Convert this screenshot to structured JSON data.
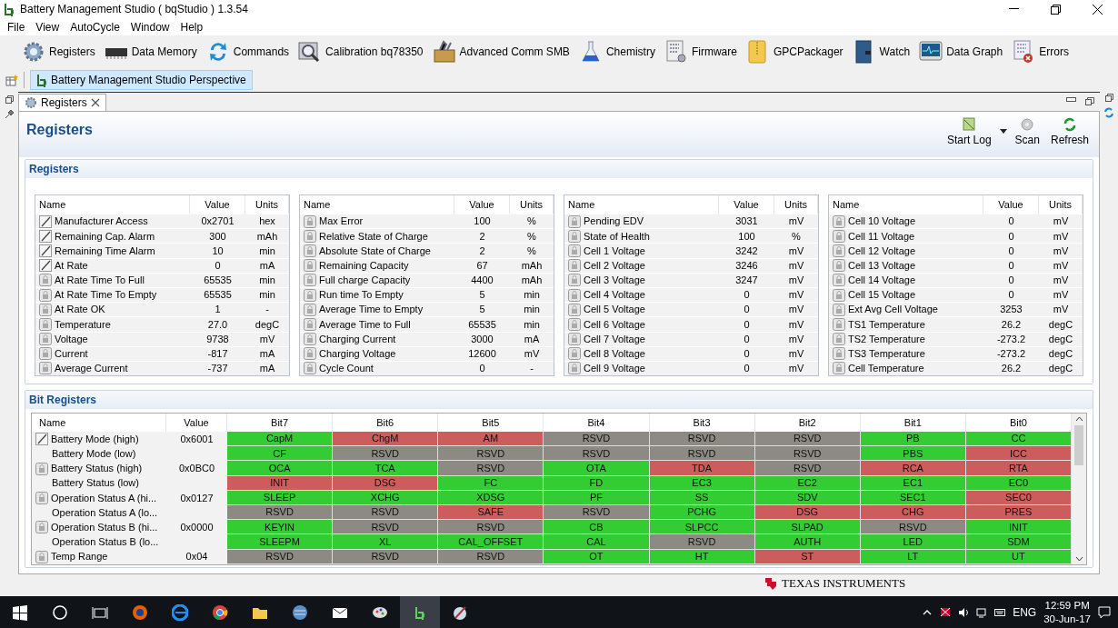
{
  "window": {
    "title": "Battery Management Studio ( bqStudio ) 1.3.54"
  },
  "menu": [
    "File",
    "View",
    "AutoCycle",
    "Window",
    "Help"
  ],
  "toolbar": [
    "Registers",
    "Data Memory",
    "Commands",
    "Calibration bq78350",
    "Advanced Comm SMB",
    "Chemistry",
    "Firmware",
    "GPCPackager",
    "Watch",
    "Data Graph",
    "Errors"
  ],
  "perspective": {
    "label": "Battery Management Studio Perspective",
    "selected": true
  },
  "view_tab": {
    "label": "Registers"
  },
  "page": {
    "title": "Registers",
    "actions": [
      "Start Log",
      "Scan",
      "Refresh"
    ]
  },
  "registers": {
    "title": "Registers",
    "tables": [
      {
        "columns": [
          "Name",
          "Value",
          "Units"
        ],
        "rows": [
          {
            "name": "Manufacturer Access",
            "value": "0x2701",
            "units": "hex",
            "kind": "writable"
          },
          {
            "name": "Remaining Cap. Alarm",
            "value": "300",
            "units": "mAh",
            "kind": "writable"
          },
          {
            "name": "Remaining Time Alarm",
            "value": "10",
            "units": "min",
            "kind": "writable"
          },
          {
            "name": "At Rate",
            "value": "0",
            "units": "mA",
            "kind": "writable"
          },
          {
            "name": "At Rate Time To Full",
            "value": "65535",
            "units": "min",
            "kind": "readonly"
          },
          {
            "name": "At Rate Time To Empty",
            "value": "65535",
            "units": "min",
            "kind": "readonly"
          },
          {
            "name": "At Rate OK",
            "value": "1",
            "units": "-",
            "kind": "readonly"
          },
          {
            "name": "Temperature",
            "value": "27.0",
            "units": "degC",
            "kind": "readonly"
          },
          {
            "name": "Voltage",
            "value": "9738",
            "units": "mV",
            "kind": "readonly"
          },
          {
            "name": "Current",
            "value": "-817",
            "units": "mA",
            "kind": "readonly"
          },
          {
            "name": "Average Current",
            "value": "-737",
            "units": "mA",
            "kind": "readonly"
          }
        ]
      },
      {
        "columns": [
          "Name",
          "Value",
          "Units"
        ],
        "rows": [
          {
            "name": "Max Error",
            "value": "100",
            "units": "%",
            "kind": "readonly"
          },
          {
            "name": "Relative State of Charge",
            "value": "2",
            "units": "%",
            "kind": "readonly"
          },
          {
            "name": "Absolute State of Charge",
            "value": "2",
            "units": "%",
            "kind": "readonly"
          },
          {
            "name": "Remaining Capacity",
            "value": "67",
            "units": "mAh",
            "kind": "readonly"
          },
          {
            "name": "Full charge Capacity",
            "value": "4400",
            "units": "mAh",
            "kind": "readonly"
          },
          {
            "name": "Run time To Empty",
            "value": "5",
            "units": "min",
            "kind": "readonly"
          },
          {
            "name": "Average Time to Empty",
            "value": "5",
            "units": "min",
            "kind": "readonly"
          },
          {
            "name": "Average Time to Full",
            "value": "65535",
            "units": "min",
            "kind": "readonly"
          },
          {
            "name": "Charging Current",
            "value": "3000",
            "units": "mA",
            "kind": "readonly"
          },
          {
            "name": "Charging Voltage",
            "value": "12600",
            "units": "mV",
            "kind": "readonly"
          },
          {
            "name": "Cycle Count",
            "value": "0",
            "units": "-",
            "kind": "readonly"
          }
        ]
      },
      {
        "columns": [
          "Name",
          "Value",
          "Units"
        ],
        "rows": [
          {
            "name": "Pending EDV",
            "value": "3031",
            "units": "mV",
            "kind": "readonly"
          },
          {
            "name": "State of Health",
            "value": "100",
            "units": "%",
            "kind": "readonly"
          },
          {
            "name": "Cell 1 Voltage",
            "value": "3242",
            "units": "mV",
            "kind": "readonly"
          },
          {
            "name": "Cell 2 Voltage",
            "value": "3246",
            "units": "mV",
            "kind": "readonly"
          },
          {
            "name": "Cell 3 Voltage",
            "value": "3247",
            "units": "mV",
            "kind": "readonly"
          },
          {
            "name": "Cell 4 Voltage",
            "value": "0",
            "units": "mV",
            "kind": "readonly"
          },
          {
            "name": "Cell 5 Voltage",
            "value": "0",
            "units": "mV",
            "kind": "readonly"
          },
          {
            "name": "Cell 6 Voltage",
            "value": "0",
            "units": "mV",
            "kind": "readonly"
          },
          {
            "name": "Cell 7 Voltage",
            "value": "0",
            "units": "mV",
            "kind": "readonly"
          },
          {
            "name": "Cell 8 Voltage",
            "value": "0",
            "units": "mV",
            "kind": "readonly"
          },
          {
            "name": "Cell 9 Voltage",
            "value": "0",
            "units": "mV",
            "kind": "readonly"
          }
        ]
      },
      {
        "columns": [
          "Name",
          "Value",
          "Units"
        ],
        "rows": [
          {
            "name": "Cell 10 Voltage",
            "value": "0",
            "units": "mV",
            "kind": "readonly"
          },
          {
            "name": "Cell 11 Voltage",
            "value": "0",
            "units": "mV",
            "kind": "readonly"
          },
          {
            "name": "Cell 12 Voltage",
            "value": "0",
            "units": "mV",
            "kind": "readonly"
          },
          {
            "name": "Cell 13 Voltage",
            "value": "0",
            "units": "mV",
            "kind": "readonly"
          },
          {
            "name": "Cell 14 Voltage",
            "value": "0",
            "units": "mV",
            "kind": "readonly"
          },
          {
            "name": "Cell 15 Voltage",
            "value": "0",
            "units": "mV",
            "kind": "readonly"
          },
          {
            "name": "Ext Avg Cell Voltage",
            "value": "3253",
            "units": "mV",
            "kind": "readonly"
          },
          {
            "name": "TS1 Temperature",
            "value": "26.2",
            "units": "degC",
            "kind": "readonly"
          },
          {
            "name": "TS2 Temperature",
            "value": "-273.2",
            "units": "degC",
            "kind": "readonly"
          },
          {
            "name": "TS3 Temperature",
            "value": "-273.2",
            "units": "degC",
            "kind": "readonly"
          },
          {
            "name": "Cell Temperature",
            "value": "26.2",
            "units": "degC",
            "kind": "readonly"
          }
        ]
      }
    ]
  },
  "bit_registers": {
    "title": "Bit Registers",
    "columns": [
      "Name",
      "Value",
      "Bit7",
      "Bit6",
      "Bit5",
      "Bit4",
      "Bit3",
      "Bit2",
      "Bit1",
      "Bit0"
    ],
    "rows": [
      {
        "name": "Battery Mode (high)",
        "value": "0x6001",
        "kind": "writable",
        "bits": [
          {
            "label": "CapM",
            "color": "#33cc33"
          },
          {
            "label": "ChgM",
            "color": "#cd5c5c"
          },
          {
            "label": "AM",
            "color": "#cd5c5c"
          },
          {
            "label": "RSVD",
            "color": "#8c8a82"
          },
          {
            "label": "RSVD",
            "color": "#8c8a82"
          },
          {
            "label": "RSVD",
            "color": "#8c8a82"
          },
          {
            "label": "PB",
            "color": "#33cc33"
          },
          {
            "label": "CC",
            "color": "#33cc33"
          }
        ]
      },
      {
        "name": "Battery Mode (low)",
        "kind": "sub",
        "bits": [
          {
            "label": "CF",
            "color": "#33cc33"
          },
          {
            "label": "RSVD",
            "color": "#8c8a82"
          },
          {
            "label": "RSVD",
            "color": "#8c8a82"
          },
          {
            "label": "RSVD",
            "color": "#8c8a82"
          },
          {
            "label": "RSVD",
            "color": "#8c8a82"
          },
          {
            "label": "RSVD",
            "color": "#8c8a82"
          },
          {
            "label": "PBS",
            "color": "#33cc33"
          },
          {
            "label": "ICC",
            "color": "#cd5c5c"
          }
        ]
      },
      {
        "name": "Battery Status (high)",
        "value": "0x0BC0",
        "kind": "readonly",
        "bits": [
          {
            "label": "OCA",
            "color": "#33cc33"
          },
          {
            "label": "TCA",
            "color": "#33cc33"
          },
          {
            "label": "RSVD",
            "color": "#8c8a82"
          },
          {
            "label": "OTA",
            "color": "#33cc33"
          },
          {
            "label": "TDA",
            "color": "#cd5c5c"
          },
          {
            "label": "RSVD",
            "color": "#8c8a82"
          },
          {
            "label": "RCA",
            "color": "#cd5c5c"
          },
          {
            "label": "RTA",
            "color": "#cd5c5c"
          }
        ]
      },
      {
        "name": "Battery Status (low)",
        "kind": "sub",
        "bits": [
          {
            "label": "INIT",
            "color": "#cd5c5c"
          },
          {
            "label": "DSG",
            "color": "#cd5c5c"
          },
          {
            "label": "FC",
            "color": "#33cc33"
          },
          {
            "label": "FD",
            "color": "#33cc33"
          },
          {
            "label": "EC3",
            "color": "#33cc33"
          },
          {
            "label": "EC2",
            "color": "#33cc33"
          },
          {
            "label": "EC1",
            "color": "#33cc33"
          },
          {
            "label": "EC0",
            "color": "#33cc33"
          }
        ]
      },
      {
        "name": "Operation Status A (hi...",
        "value": "0x0127",
        "kind": "readonly",
        "bits": [
          {
            "label": "SLEEP",
            "color": "#33cc33"
          },
          {
            "label": "XCHG",
            "color": "#33cc33"
          },
          {
            "label": "XDSG",
            "color": "#33cc33"
          },
          {
            "label": "PF",
            "color": "#33cc33"
          },
          {
            "label": "SS",
            "color": "#33cc33"
          },
          {
            "label": "SDV",
            "color": "#33cc33"
          },
          {
            "label": "SEC1",
            "color": "#33cc33"
          },
          {
            "label": "SEC0",
            "color": "#cd5c5c"
          }
        ]
      },
      {
        "name": "Operation Status A (lo...",
        "kind": "sub",
        "bits": [
          {
            "label": "RSVD",
            "color": "#8c8a82"
          },
          {
            "label": "RSVD",
            "color": "#8c8a82"
          },
          {
            "label": "SAFE",
            "color": "#cd5c5c"
          },
          {
            "label": "RSVD",
            "color": "#8c8a82"
          },
          {
            "label": "PCHG",
            "color": "#33cc33"
          },
          {
            "label": "DSG",
            "color": "#cd5c5c"
          },
          {
            "label": "CHG",
            "color": "#cd5c5c"
          },
          {
            "label": "PRES",
            "color": "#cd5c5c"
          }
        ]
      },
      {
        "name": "Operation Status B (hi...",
        "value": "0x0000",
        "kind": "readonly",
        "bits": [
          {
            "label": "KEYIN",
            "color": "#33cc33"
          },
          {
            "label": "RSVD",
            "color": "#8c8a82"
          },
          {
            "label": "RSVD",
            "color": "#8c8a82"
          },
          {
            "label": "CB",
            "color": "#33cc33"
          },
          {
            "label": "SLPCC",
            "color": "#33cc33"
          },
          {
            "label": "SLPAD",
            "color": "#33cc33"
          },
          {
            "label": "RSVD",
            "color": "#8c8a82"
          },
          {
            "label": "INIT",
            "color": "#33cc33"
          }
        ]
      },
      {
        "name": "Operation Status B (lo...",
        "kind": "sub",
        "bits": [
          {
            "label": "SLEEPM",
            "color": "#33cc33"
          },
          {
            "label": "XL",
            "color": "#33cc33"
          },
          {
            "label": "CAL_OFFSET",
            "color": "#33cc33"
          },
          {
            "label": "CAL",
            "color": "#33cc33"
          },
          {
            "label": "RSVD",
            "color": "#8c8a82"
          },
          {
            "label": "AUTH",
            "color": "#33cc33"
          },
          {
            "label": "LED",
            "color": "#33cc33"
          },
          {
            "label": "SDM",
            "color": "#33cc33"
          }
        ]
      },
      {
        "name": "Temp Range",
        "value": "0x04",
        "kind": "readonly",
        "bits": [
          {
            "label": "RSVD",
            "color": "#8c8a82"
          },
          {
            "label": "RSVD",
            "color": "#8c8a82"
          },
          {
            "label": "RSVD",
            "color": "#8c8a82"
          },
          {
            "label": "OT",
            "color": "#33cc33"
          },
          {
            "label": "HT",
            "color": "#33cc33"
          },
          {
            "label": "ST",
            "color": "#cd5c5c"
          },
          {
            "label": "LT",
            "color": "#33cc33"
          },
          {
            "label": "UT",
            "color": "#33cc33"
          }
        ]
      }
    ]
  },
  "footer_logo": "TEXAS INSTRUMENTS",
  "taskbar": {
    "language": "ENG",
    "time": "12:59 PM",
    "date": "30-Jun-17"
  }
}
